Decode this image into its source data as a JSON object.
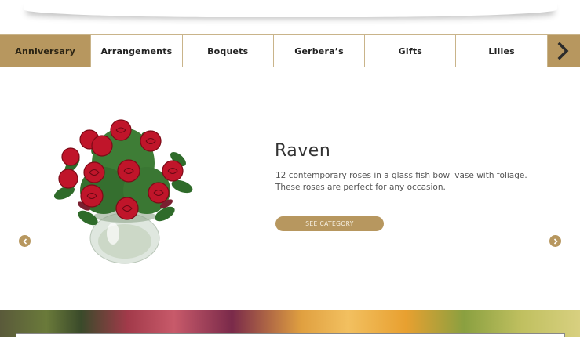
{
  "tabs": [
    {
      "label": "Anniversary",
      "active": true
    },
    {
      "label": "Arrangements",
      "active": false
    },
    {
      "label": "Boquets",
      "active": false
    },
    {
      "label": "Gerbera’s",
      "active": false
    },
    {
      "label": "Gifts",
      "active": false
    },
    {
      "label": "Lilies",
      "active": false
    }
  ],
  "product": {
    "title": "Raven",
    "description": "12 contemporary  roses in a glass fish bowl vase with foliage. These roses are perfect for any occasion.",
    "cta_label": "SEE CATEGORY"
  },
  "colors": {
    "accent": "#b7975f",
    "tab_border": "#c9b48a",
    "rose": "#c0152a",
    "leaf": "#2f6b2a"
  },
  "icons": {
    "tab_next": "chevron-right-icon",
    "slide_prev": "chevron-left-icon",
    "slide_next": "chevron-right-icon"
  }
}
